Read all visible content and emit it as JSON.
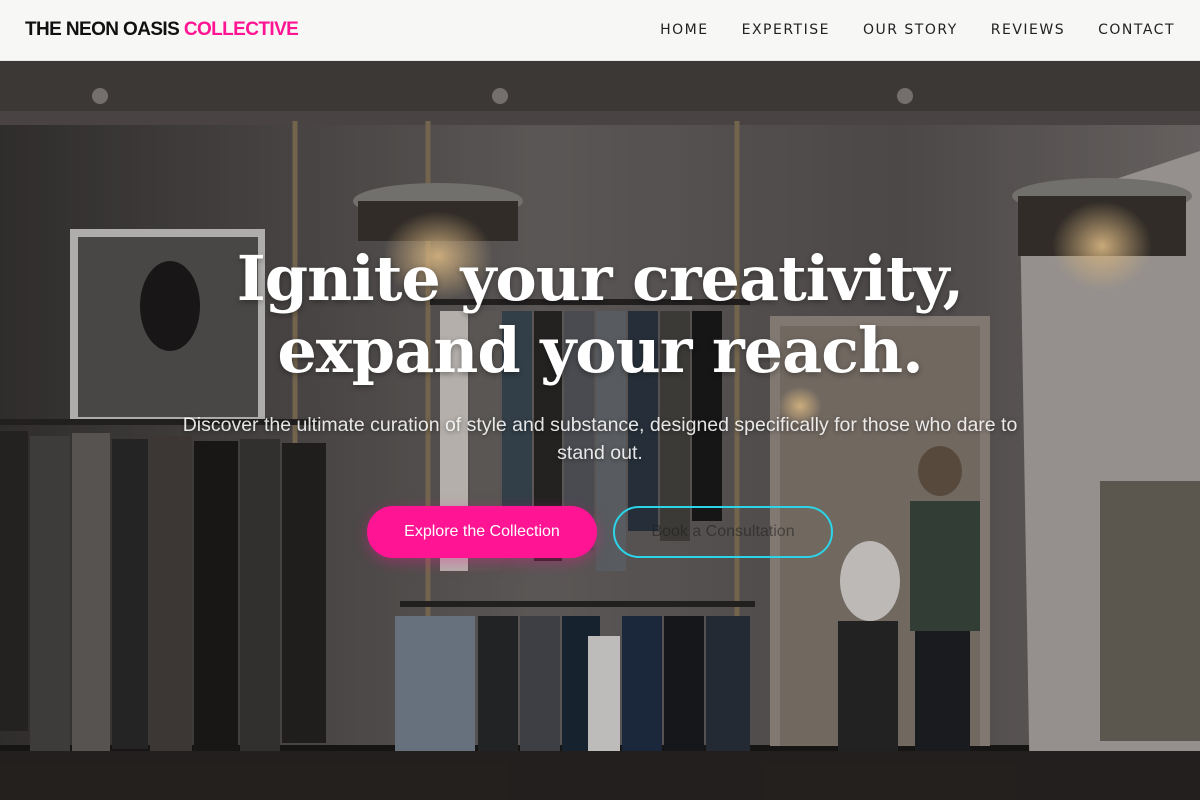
{
  "navbar": {
    "brand_main": "THE NEON OASIS",
    "brand_accent": "COLLECTIVE",
    "links": [
      "HOME",
      "EXPERTISE",
      "OUR STORY",
      "REVIEWS",
      "CONTACT"
    ]
  },
  "hero": {
    "headline_line1": "Ignite your creativity,",
    "headline_line2": "expand your reach.",
    "subtitle": "Discover the ultimate curation of style and substance, designed specifically for those who dare to stand out.",
    "primary_button": "Explore the Collection",
    "secondary_button": "Book a Consultation"
  },
  "colors": {
    "accent_pink": "#ff1493",
    "accent_cyan": "#2bd4e8",
    "navbar_bg": "#f7f7f6"
  }
}
